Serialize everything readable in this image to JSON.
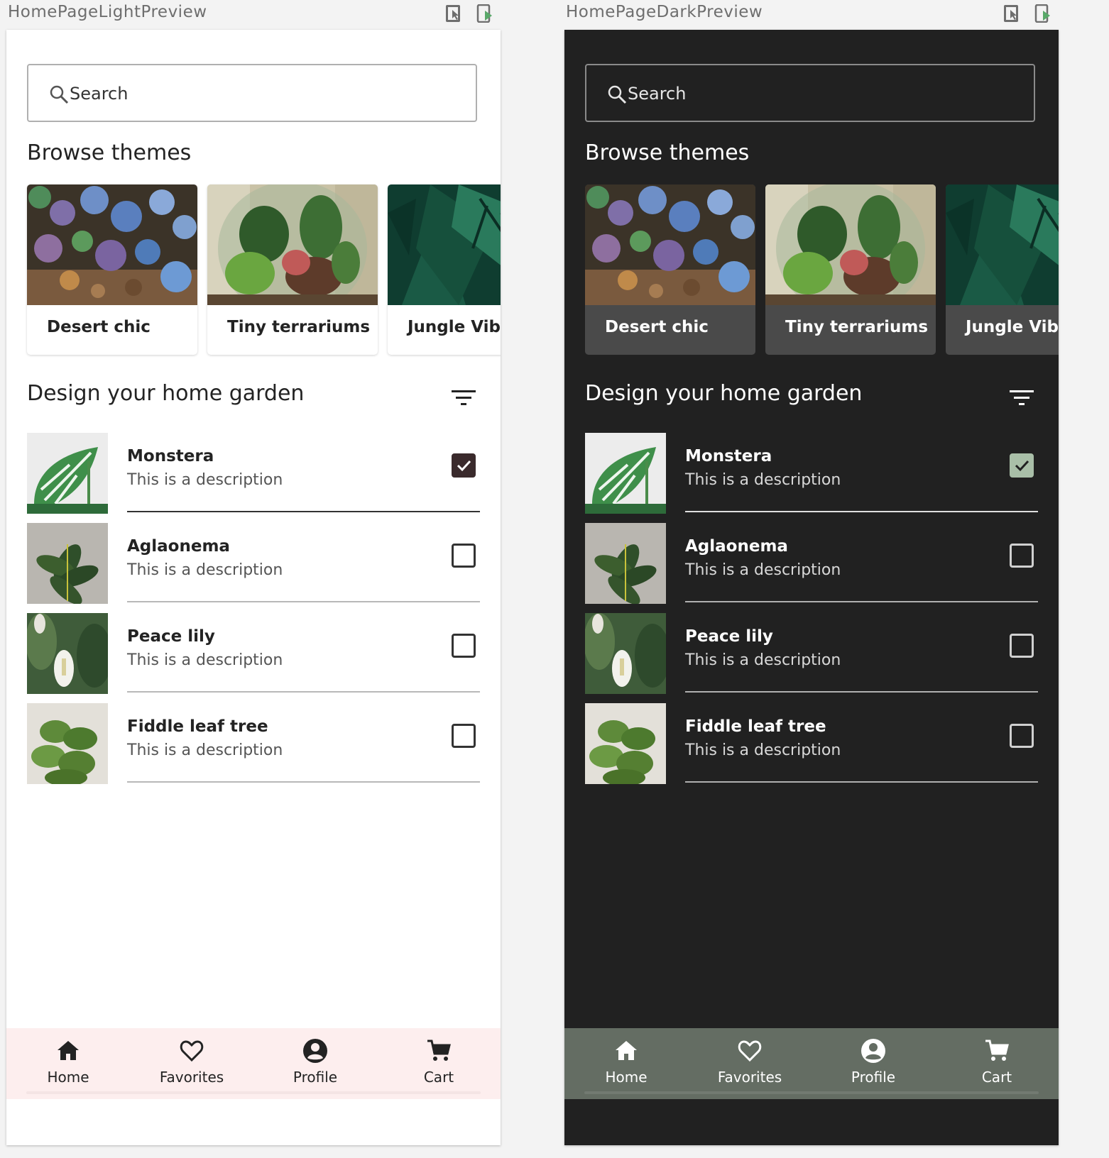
{
  "colors": {
    "light_background": "#ffffff",
    "light_text": "#232323",
    "light_nav_background": "#fdeeee",
    "light_checkbox_checked": "#3a2a2c",
    "dark_background": "#212121",
    "dark_card": "#4a4a4a",
    "dark_nav_background": "#646d63",
    "dark_checkbox_checked": "#a9bfa8"
  },
  "previews": [
    {
      "title": "HomePageLightPreview",
      "search": {
        "placeholder": "Search"
      },
      "browse_title": "Browse themes",
      "themes": [
        {
          "label": "Desert chic",
          "image": "succulents-photo"
        },
        {
          "label": "Tiny terrariums",
          "image": "terrarium-photo"
        },
        {
          "label": "Jungle Vibes",
          "image": "monstera-leaves-photo"
        }
      ],
      "garden_title": "Design your home garden",
      "plants": [
        {
          "name": "Monstera",
          "description": "This is a description",
          "checked": true
        },
        {
          "name": "Aglaonema",
          "description": "This is a description",
          "checked": false
        },
        {
          "name": "Peace lily",
          "description": "This is a description",
          "checked": false
        },
        {
          "name": "Fiddle leaf tree",
          "description": "This is a description",
          "checked": false
        }
      ],
      "nav": [
        {
          "label": "Home",
          "icon": "home-icon"
        },
        {
          "label": "Favorites",
          "icon": "heart-outline-icon"
        },
        {
          "label": "Profile",
          "icon": "account-circle-icon"
        },
        {
          "label": "Cart",
          "icon": "shopping-cart-icon"
        }
      ]
    },
    {
      "title": "HomePageDarkPreview",
      "search": {
        "placeholder": "Search"
      },
      "browse_title": "Browse themes",
      "themes": [
        {
          "label": "Desert chic",
          "image": "succulents-photo"
        },
        {
          "label": "Tiny terrariums",
          "image": "terrarium-photo"
        },
        {
          "label": "Jungle Vibes",
          "image": "monstera-leaves-photo"
        }
      ],
      "garden_title": "Design your home garden",
      "plants": [
        {
          "name": "Monstera",
          "description": "This is a description",
          "checked": true
        },
        {
          "name": "Aglaonema",
          "description": "This is a description",
          "checked": false
        },
        {
          "name": "Peace lily",
          "description": "This is a description",
          "checked": false
        },
        {
          "name": "Fiddle leaf tree",
          "description": "This is a description",
          "checked": false
        }
      ],
      "nav": [
        {
          "label": "Home",
          "icon": "home-icon"
        },
        {
          "label": "Favorites",
          "icon": "heart-outline-icon"
        },
        {
          "label": "Profile",
          "icon": "account-circle-icon"
        },
        {
          "label": "Cart",
          "icon": "shopping-cart-icon"
        }
      ]
    }
  ]
}
